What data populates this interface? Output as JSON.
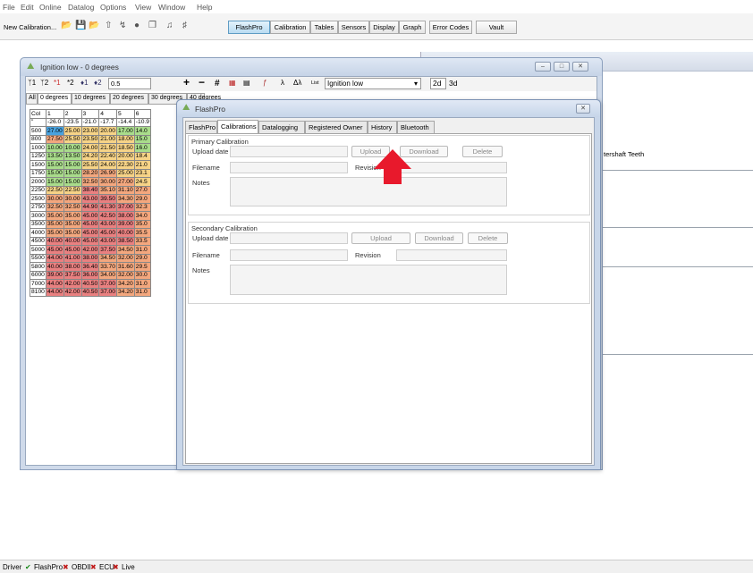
{
  "menu": [
    "File",
    "Edit",
    "Online",
    "Datalog",
    "Options",
    "View",
    "Window",
    "Help"
  ],
  "toolbar": {
    "new_calibration": "New Calibration...",
    "flashpro": "FlashPro",
    "calibration": "Calibration",
    "tables": "Tables",
    "sensors": "Sensors",
    "display": "Display",
    "graph": "Graph",
    "error_codes": "Error Codes",
    "vault": "Vault"
  },
  "background_window": {
    "text": "tershaft Teeth"
  },
  "ignition_window": {
    "title": "Ignition low - 0 degrees",
    "step_value": "0.5",
    "table_select": "Ignition low",
    "mode_2d": "2d",
    "mode_3d": "3d",
    "list_label": "List",
    "tabs": [
      "All",
      "0 degrees",
      "10 degrees",
      "20 degrees",
      "30 degrees",
      "40 degrees"
    ],
    "grid": {
      "col_label": "Col",
      "col_numbers": [
        "1",
        "2",
        "3",
        "4",
        "5",
        "6"
      ],
      "col_values": [
        "-26.0",
        "-23.5",
        "-21.0",
        "-17.7",
        "-14.4",
        "-10.9"
      ],
      "row_quote": "\"",
      "rows": [
        {
          "rpm": "500",
          "values": [
            "27.00",
            "25.00",
            "23.00",
            "20.00",
            "17.00",
            "14.0"
          ]
        },
        {
          "rpm": "800",
          "values": [
            "27.50",
            "25.50",
            "23.50",
            "21.00",
            "18.00",
            "15.0"
          ]
        },
        {
          "rpm": "1000",
          "values": [
            "10.00",
            "10.00",
            "24.00",
            "21.50",
            "18.50",
            "16.0"
          ]
        },
        {
          "rpm": "1250",
          "values": [
            "13.50",
            "13.50",
            "24.20",
            "22.40",
            "20.00",
            "18.4"
          ]
        },
        {
          "rpm": "1500",
          "values": [
            "15.00",
            "15.00",
            "25.50",
            "24.00",
            "22.30",
            "21.0"
          ]
        },
        {
          "rpm": "1750",
          "values": [
            "15.00",
            "15.00",
            "28.20",
            "26.90",
            "25.00",
            "23.1"
          ]
        },
        {
          "rpm": "2000",
          "values": [
            "15.00",
            "15.00",
            "32.50",
            "30.00",
            "27.00",
            "24.5"
          ]
        },
        {
          "rpm": "2250",
          "values": [
            "22.50",
            "22.50",
            "38.40",
            "35.10",
            "31.10",
            "27.0"
          ]
        },
        {
          "rpm": "2500",
          "values": [
            "30.00",
            "30.00",
            "43.00",
            "39.50",
            "34.30",
            "29.0"
          ]
        },
        {
          "rpm": "2750",
          "values": [
            "32.50",
            "32.50",
            "44.90",
            "41.30",
            "37.00",
            "32.3"
          ]
        },
        {
          "rpm": "3000",
          "values": [
            "35.00",
            "35.00",
            "45.00",
            "42.50",
            "38.00",
            "34.0"
          ]
        },
        {
          "rpm": "3500",
          "values": [
            "35.00",
            "35.00",
            "45.00",
            "43.00",
            "39.00",
            "35.0"
          ]
        },
        {
          "rpm": "4000",
          "values": [
            "35.00",
            "35.00",
            "45.00",
            "45.00",
            "40.00",
            "35.5"
          ]
        },
        {
          "rpm": "4500",
          "values": [
            "40.00",
            "40.00",
            "45.00",
            "43.00",
            "38.50",
            "33.5"
          ]
        },
        {
          "rpm": "5000",
          "values": [
            "45.00",
            "45.00",
            "42.00",
            "37.50",
            "34.50",
            "31.0"
          ]
        },
        {
          "rpm": "5500",
          "values": [
            "44.00",
            "41.00",
            "38.00",
            "34.50",
            "32.00",
            "29.0"
          ]
        },
        {
          "rpm": "5800",
          "values": [
            "40.00",
            "38.00",
            "36.40",
            "33.70",
            "31.60",
            "29.5"
          ]
        },
        {
          "rpm": "6000",
          "values": [
            "39.00",
            "37.50",
            "36.00",
            "34.00",
            "32.00",
            "30.0"
          ]
        },
        {
          "rpm": "7000",
          "values": [
            "44.00",
            "42.00",
            "40.50",
            "37.00",
            "34.20",
            "31.0"
          ]
        },
        {
          "rpm": "8100",
          "values": [
            "44.00",
            "42.00",
            "40.50",
            "37.00",
            "34.20",
            "31.0"
          ]
        }
      ]
    }
  },
  "flashpro_dialog": {
    "title": "FlashPro",
    "tabs": [
      "FlashPro",
      "Calibrations",
      "Datalogging",
      "Registered Owner",
      "History",
      "Bluetooth"
    ],
    "primary": {
      "group_title": "Primary Calibration",
      "upload_date_label": "Upload date",
      "filename_label": "Filename",
      "revision_label": "Revision",
      "notes_label": "Notes",
      "upload": "Upload",
      "download": "Download",
      "delete": "Delete"
    },
    "secondary": {
      "group_title": "Secondary Calibration",
      "upload_date_label": "Upload date",
      "filename_label": "Filename",
      "revision_label": "Revision",
      "notes_label": "Notes",
      "upload": "Upload",
      "download": "Download",
      "delete": "Delete"
    }
  },
  "status_bar": {
    "driver": "Driver",
    "flashpro": "FlashPro",
    "obdii": "OBDII",
    "ecu": "ECU",
    "live": "Live"
  },
  "colors": {
    "arrow": "#e8192c",
    "grid_blue": "#4aa3df",
    "grid_green": "#a9dc8b",
    "grid_yellow": "#f6d387",
    "grid_orange": "#f3a77e",
    "grid_red": "#e98080"
  },
  "icons": [
    "ignition-icon",
    "flashpro-icon",
    "open-folder-icon",
    "save-icon",
    "up-arrow-icon",
    "status-check-icon",
    "status-cross-icon",
    "red-pointer-arrow"
  ]
}
